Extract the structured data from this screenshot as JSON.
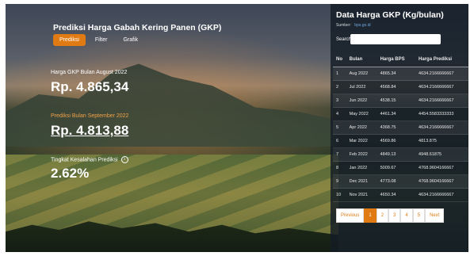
{
  "app": {
    "title": "Prediksi Harga Gabah Kering Panen (GKP)",
    "tabs": [
      {
        "label": "Prediksi",
        "active": true
      },
      {
        "label": "Filter",
        "active": false
      },
      {
        "label": "Grafik",
        "active": false
      }
    ]
  },
  "metrics": {
    "current_label": "Harga GKP Bulan August 2022",
    "current_value": "Rp. 4.865,34",
    "prediction_label": "Prediksi Bulan September 2022",
    "prediction_value": "Rp. 4.813,88",
    "error_label": "Tingkat Kesalahan Prediksi",
    "error_value": "2.62%",
    "info_icon": "i"
  },
  "table_panel": {
    "title": "Data Harga GKP (Kg/bulan)",
    "source_label": "Sumber:",
    "source_link": "bps.go.id",
    "search_label": "Search:",
    "search_value": "",
    "columns": [
      "No",
      "Bulan",
      "Harga BPS",
      "Harga Prediksi"
    ],
    "rows": [
      [
        "1",
        "Aug 2022",
        "4865.34",
        "4634.2166666667"
      ],
      [
        "2",
        "Jul 2022",
        "4568.84",
        "4634.2166666667"
      ],
      [
        "3",
        "Jun 2022",
        "4538.15",
        "4634.2166666667"
      ],
      [
        "4",
        "May 2022",
        "4461.34",
        "4454.5583333333"
      ],
      [
        "5",
        "Apr 2022",
        "4368.75",
        "4634.2166666667"
      ],
      [
        "6",
        "Mar 2022",
        "4569.86",
        "4813.875"
      ],
      [
        "7",
        "Feb 2022",
        "4849.13",
        "4948.61875"
      ],
      [
        "8",
        "Jan 2022",
        "5009.67",
        "4768.9604166667"
      ],
      [
        "9",
        "Dec 2021",
        "4773.08",
        "4768.9604166667"
      ],
      [
        "10",
        "Nov 2021",
        "4650.34",
        "4634.2166666667"
      ]
    ],
    "pagination": {
      "previous": "Previous",
      "pages": [
        "1",
        "2",
        "3",
        "4",
        "5"
      ],
      "active_page": "1",
      "next": "Next"
    }
  },
  "colors": {
    "accent": "#e07b13",
    "panel_bg": "#141c26"
  }
}
